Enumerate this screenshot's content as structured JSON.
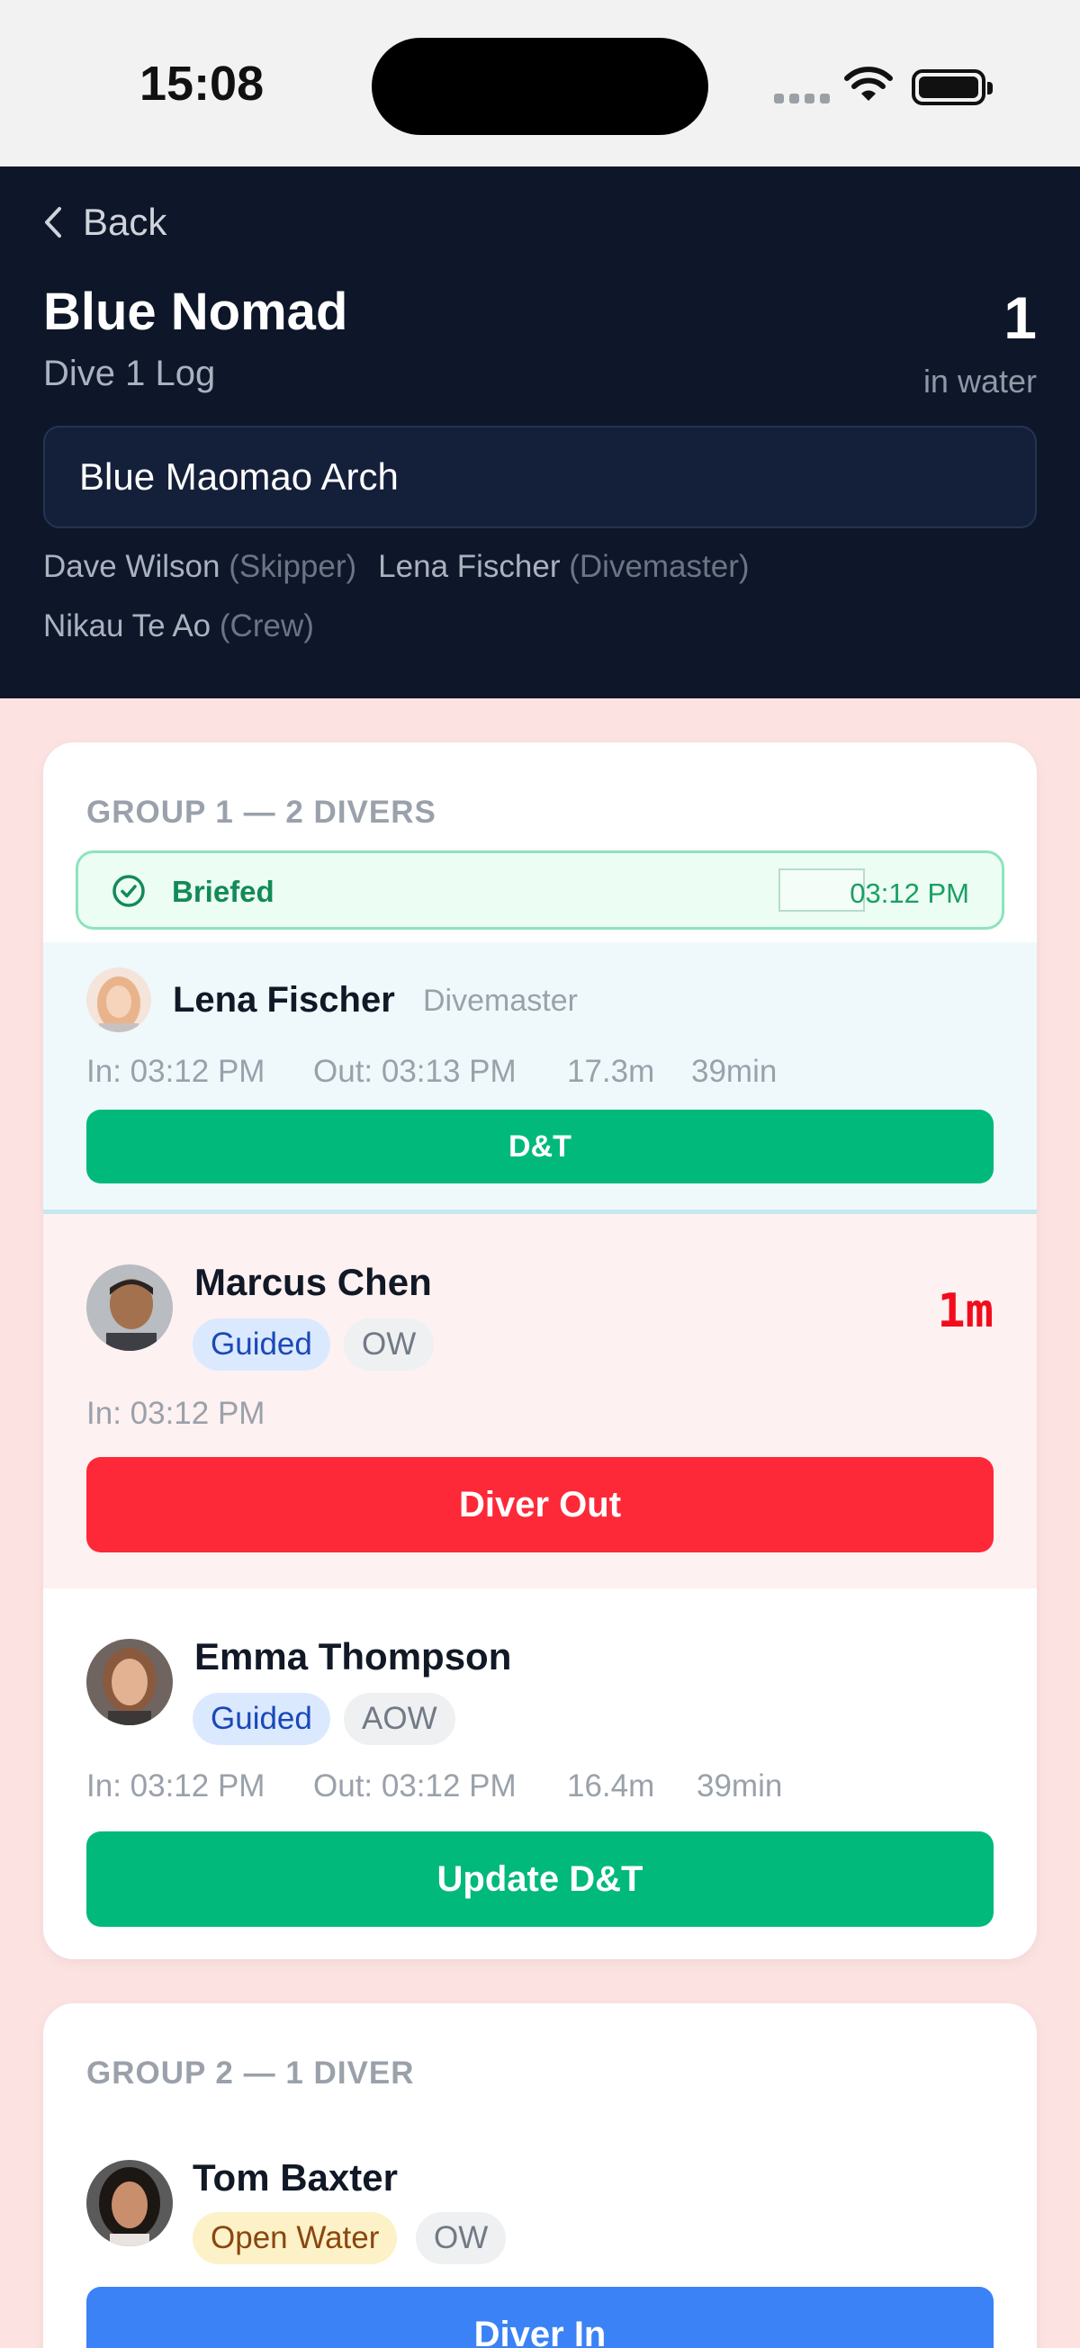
{
  "status_bar": {
    "time": "15:08"
  },
  "header": {
    "back_label": "Back",
    "boat_name": "Blue Nomad",
    "dive_log": "Dive 1 Log",
    "in_water_count": "1",
    "in_water_label": "in water",
    "site_value": "Blue Maomao Arch",
    "crew": [
      {
        "name": "Dave Wilson",
        "role": "(Skipper)"
      },
      {
        "name": "Lena Fischer",
        "role": "(Divemaster)"
      },
      {
        "name": "Nikau Te Ao",
        "role": "(Crew)"
      }
    ]
  },
  "groups": [
    {
      "title": "GROUP 1 — 2 DIVERS",
      "briefed": {
        "label": "Briefed",
        "time": "03:12 PM"
      },
      "leader": {
        "name": "Lena Fischer",
        "role": "Divemaster",
        "time_in": "In: 03:12 PM",
        "time_out": "Out: 03:13 PM",
        "depth": "17.3m",
        "duration": "39min",
        "button": "D&T"
      },
      "divers": [
        {
          "name": "Marcus Chen",
          "badge": "Guided",
          "cert": "OW",
          "timer": "1m",
          "time_in": "In: 03:12 PM",
          "button": "Diver Out"
        },
        {
          "name": "Emma Thompson",
          "badge": "Guided",
          "cert": "AOW",
          "time_in": "In: 03:12 PM",
          "time_out": "Out: 03:12 PM",
          "depth": "16.4m",
          "duration": "39min",
          "button": "Update D&T"
        }
      ]
    },
    {
      "title": "GROUP 2 — 1 DIVER",
      "divers": [
        {
          "name": "Tom Baxter",
          "badge": "Open Water",
          "cert": "OW",
          "button": "Diver In"
        }
      ]
    }
  ],
  "colors": {
    "header_bg": "#0e1629",
    "page_bg": "#fde2e2",
    "green": "#00b97a",
    "red": "#fd2938",
    "blue": "#3b82f6"
  }
}
